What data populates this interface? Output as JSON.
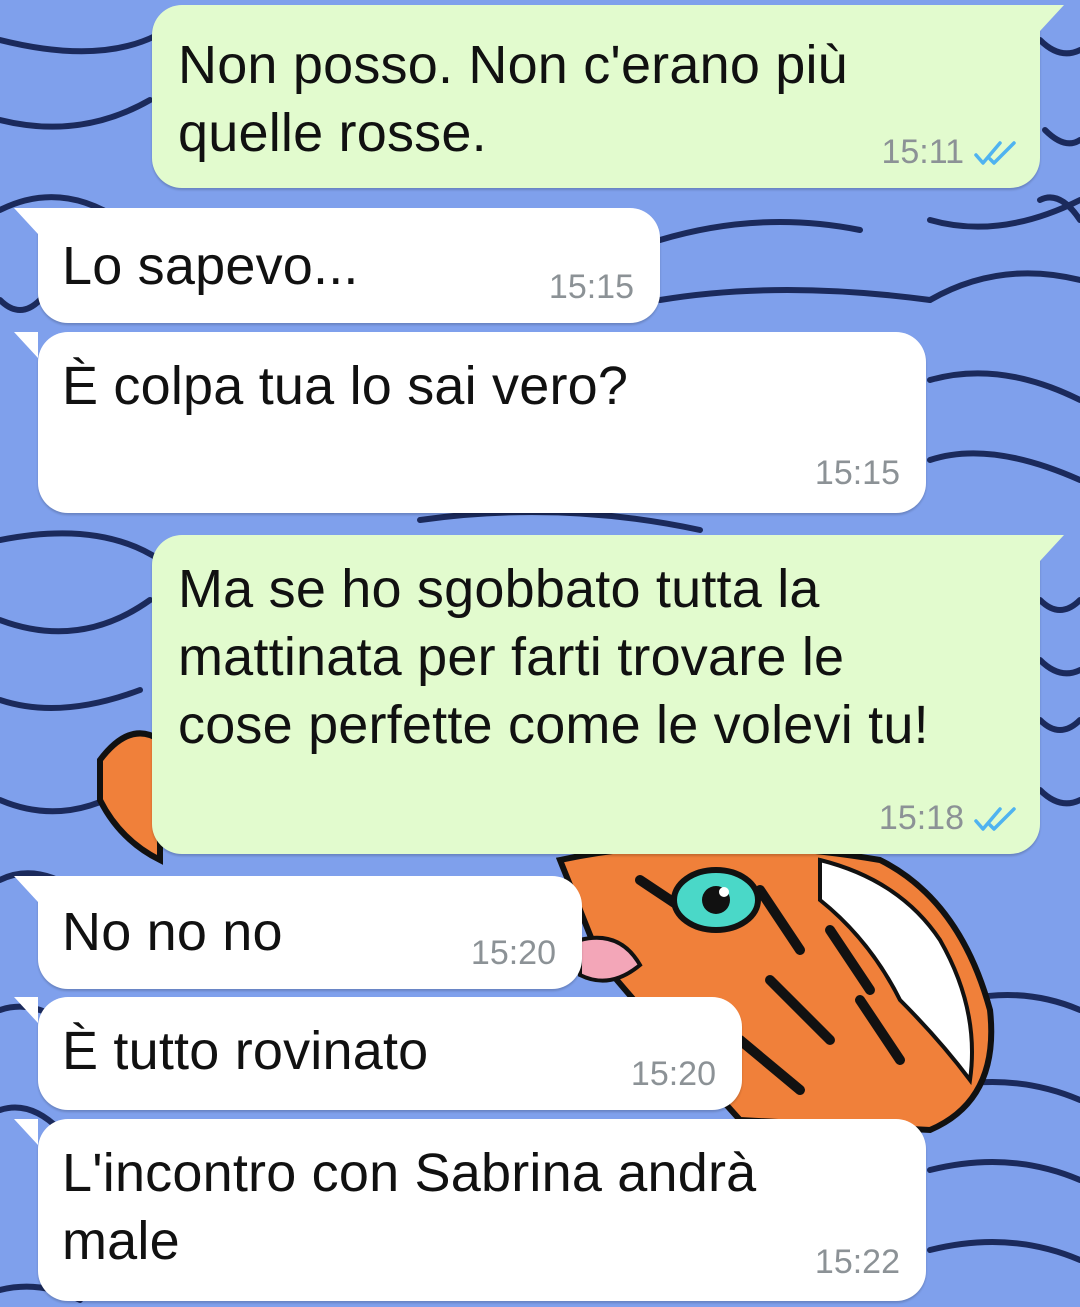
{
  "chat": {
    "messages": [
      {
        "direction": "outgoing",
        "text": "Non posso. Non c'erano più\nquelle rosse.",
        "time": "15:11",
        "status_icon": "double-check-icon"
      },
      {
        "direction": "incoming",
        "text": "Lo sapevo...",
        "time": "15:15"
      },
      {
        "direction": "incoming",
        "text": "È colpa tua lo sai vero?",
        "time": "15:15"
      },
      {
        "direction": "outgoing",
        "text": "Ma se ho sgobbato tutta la\nmattinata per farti trovare le\ncose perfette come le volevi tu!",
        "time": "15:18",
        "status_icon": "double-check-icon"
      },
      {
        "direction": "incoming",
        "text": "No no no",
        "time": "15:20"
      },
      {
        "direction": "incoming",
        "text": "È tutto rovinato",
        "time": "15:20"
      },
      {
        "direction": "incoming",
        "text": "L'incontro con Sabrina andrà\nmale",
        "time": "15:22"
      }
    ]
  },
  "colors": {
    "outgoing_bubble": "#e2fbce",
    "incoming_bubble": "#ffffff",
    "read_ticks": "#4fb3f0",
    "timestamp": "#8c9296",
    "wallpaper_blue": "#7fa0ec"
  },
  "wallpaper": {
    "description_icon": "tiger-wallpaper"
  }
}
